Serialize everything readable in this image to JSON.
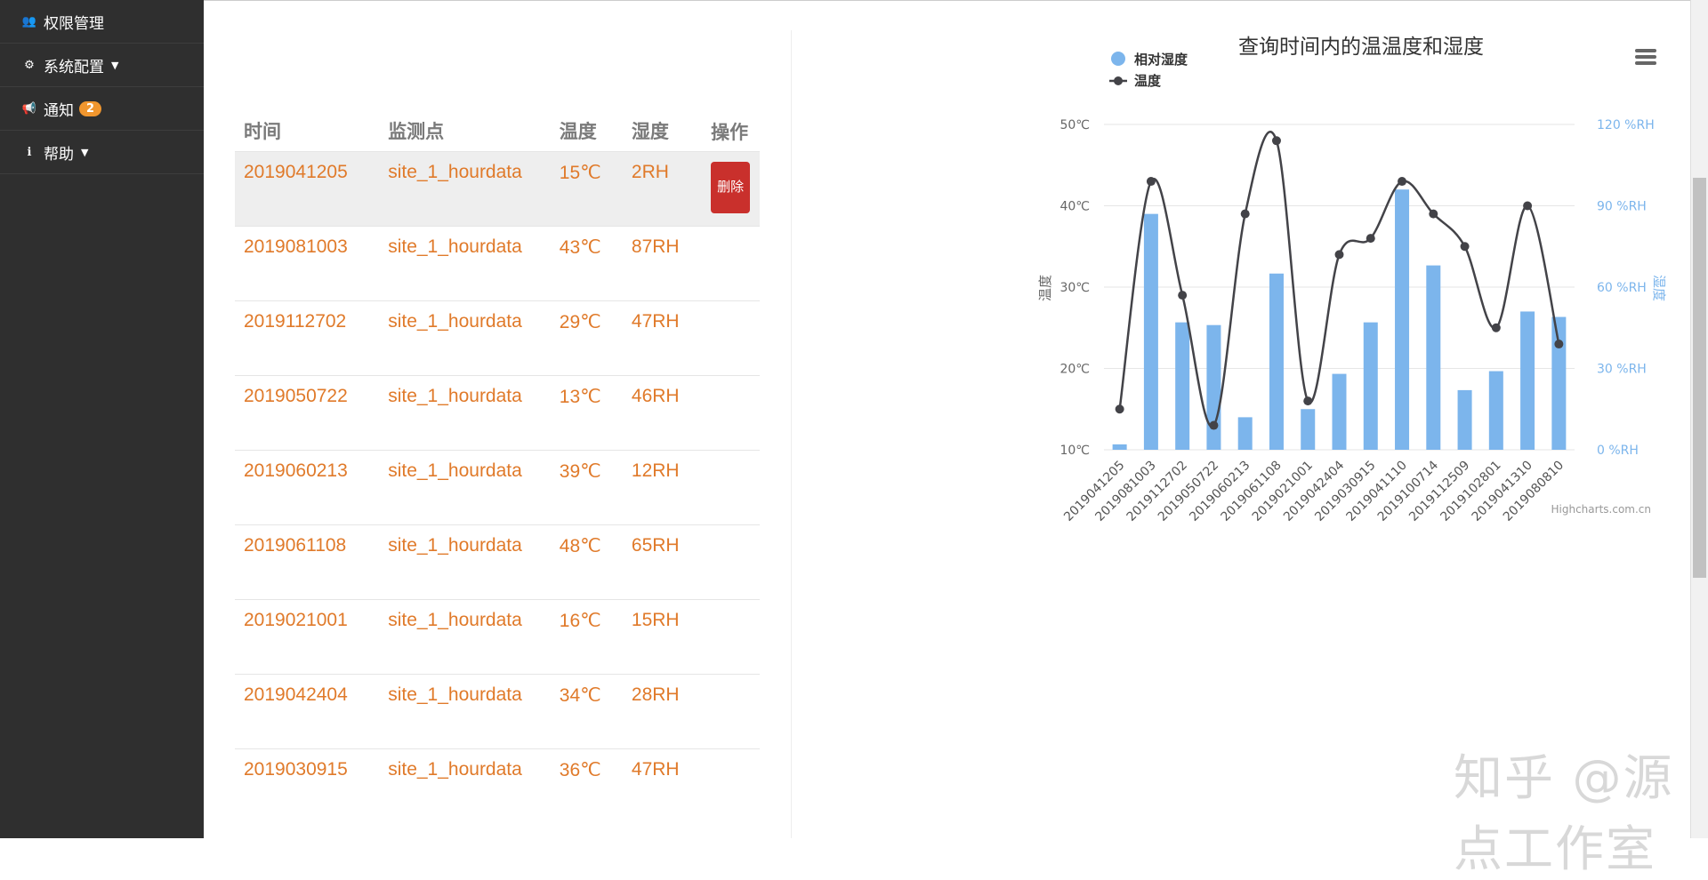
{
  "sidebar": {
    "items": [
      {
        "label": "权限管理",
        "icon": "users-icon",
        "caret": false
      },
      {
        "label": "系统配置",
        "icon": "gears-icon",
        "caret": true
      },
      {
        "label": "通知",
        "icon": "bullhorn-icon",
        "badge": "2"
      },
      {
        "label": "帮助",
        "icon": "info-icon",
        "caret": true
      }
    ]
  },
  "table": {
    "headers": [
      "时间",
      "监测点",
      "温度",
      "湿度",
      "操作"
    ],
    "delete_label": "删除",
    "rows": [
      {
        "time": "2019041205",
        "site": "site_1_hourdata",
        "temp": "15℃",
        "humidity": "2RH"
      },
      {
        "time": "2019081003",
        "site": "site_1_hourdata",
        "temp": "43℃",
        "humidity": "87RH"
      },
      {
        "time": "2019112702",
        "site": "site_1_hourdata",
        "temp": "29℃",
        "humidity": "47RH"
      },
      {
        "time": "2019050722",
        "site": "site_1_hourdata",
        "temp": "13℃",
        "humidity": "46RH"
      },
      {
        "time": "2019060213",
        "site": "site_1_hourdata",
        "temp": "39℃",
        "humidity": "12RH"
      },
      {
        "time": "2019061108",
        "site": "site_1_hourdata",
        "temp": "48℃",
        "humidity": "65RH"
      },
      {
        "time": "2019021001",
        "site": "site_1_hourdata",
        "temp": "16℃",
        "humidity": "15RH"
      },
      {
        "time": "2019042404",
        "site": "site_1_hourdata",
        "temp": "34℃",
        "humidity": "28RH"
      },
      {
        "time": "2019030915",
        "site": "site_1_hourdata",
        "temp": "36℃",
        "humidity": "47RH"
      }
    ]
  },
  "chart_data": {
    "type": "bar",
    "title": "查询时间内的温温度和湿度",
    "categories": [
      "2019041205",
      "2019081003",
      "2019112702",
      "2019050722",
      "2019060213",
      "2019061108",
      "2019021001",
      "2019042404",
      "2019030915",
      "2019041110",
      "2019100714",
      "2019112509",
      "2019102801",
      "2019041310",
      "2019080810"
    ],
    "series": [
      {
        "name": "相对湿度",
        "type": "bar",
        "axis": "right",
        "color": "#7cb5ec",
        "values": [
          2,
          87,
          47,
          46,
          12,
          65,
          15,
          28,
          47,
          96,
          68,
          22,
          29,
          51,
          49
        ]
      },
      {
        "name": "温度",
        "type": "spline",
        "axis": "left",
        "color": "#434348",
        "values": [
          15,
          43,
          29,
          13,
          39,
          48,
          16,
          34,
          36,
          43,
          39,
          35,
          25,
          40,
          23
        ]
      }
    ],
    "y_left": {
      "label": "温度",
      "min": 10,
      "max": 50,
      "ticks": [
        "10℃",
        "20℃",
        "30℃",
        "40℃",
        "50℃"
      ]
    },
    "y_right": {
      "label": "湿度",
      "min": 0,
      "max": 120,
      "ticks": [
        "0 %RH",
        "30 %RH",
        "60 %RH",
        "90 %RH",
        "120 %RH"
      ]
    },
    "legend_position": "top-left",
    "credits": "Highcharts.com.cn",
    "grid": true
  },
  "watermark": "知乎 @源点工作室"
}
